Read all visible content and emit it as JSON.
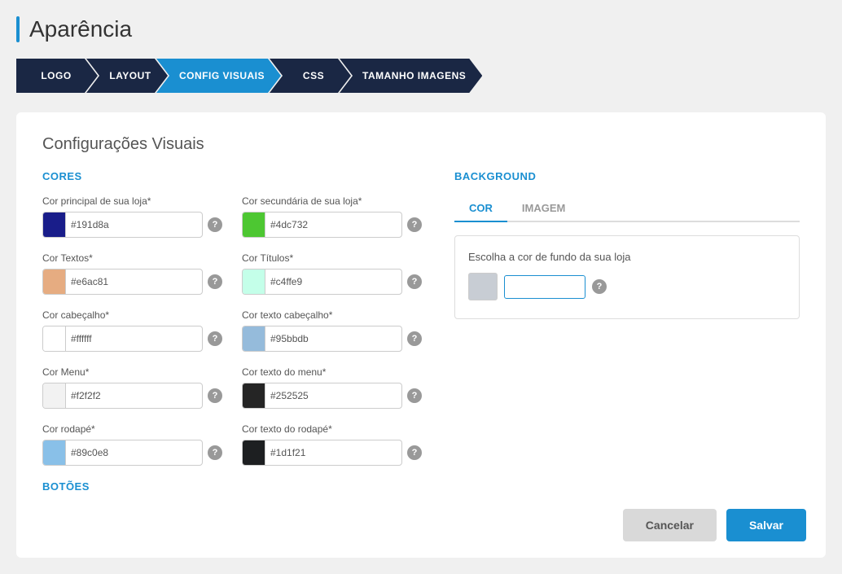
{
  "page": {
    "title": "Aparência"
  },
  "nav": {
    "steps": [
      {
        "id": "logo",
        "label": "LOGO",
        "active": false,
        "first": true
      },
      {
        "id": "layout",
        "label": "LAYOUT",
        "active": false,
        "first": false
      },
      {
        "id": "config-visuais",
        "label": "CONFIG VISUAIS",
        "active": true,
        "first": false
      },
      {
        "id": "css",
        "label": "CSS",
        "active": false,
        "first": false
      },
      {
        "id": "tamanho-imagens",
        "label": "TAMANHO IMAGENS",
        "active": false,
        "first": false
      }
    ]
  },
  "main": {
    "section_title": "Configurações Visuais",
    "cores_heading": "CORES",
    "botoes_heading": "BOTÕES",
    "colors": [
      {
        "row": [
          {
            "label": "Cor principal de sua loja*",
            "hex": "#191d8a",
            "swatch": "#191d8a"
          },
          {
            "label": "Cor secundária de sua loja*",
            "hex": "#4dc732",
            "swatch": "#4dc732"
          }
        ]
      },
      {
        "row": [
          {
            "label": "Cor Textos*",
            "hex": "#e6ac81",
            "swatch": "#e6ac81"
          },
          {
            "label": "Cor Títulos*",
            "hex": "#c4ffe9",
            "swatch": "#c4ffe9"
          }
        ]
      },
      {
        "row": [
          {
            "label": "Cor cabeçalho*",
            "hex": "#ffffff",
            "swatch": "#ffffff"
          },
          {
            "label": "Cor texto cabeçalho*",
            "hex": "#95bbdb",
            "swatch": "#95bbdb"
          }
        ]
      },
      {
        "row": [
          {
            "label": "Cor Menu*",
            "hex": "#f2f2f2",
            "swatch": "#f2f2f2"
          },
          {
            "label": "Cor texto do menu*",
            "hex": "#252525",
            "swatch": "#252525"
          }
        ]
      },
      {
        "row": [
          {
            "label": "Cor rodapé*",
            "hex": "#89c0e8",
            "swatch": "#89c0e8"
          },
          {
            "label": "Cor texto do rodapé*",
            "hex": "#1d1f21",
            "swatch": "#1d1f21"
          }
        ]
      }
    ],
    "background": {
      "heading": "BACKGROUND",
      "tabs": [
        {
          "id": "cor",
          "label": "COR",
          "active": true
        },
        {
          "id": "imagem",
          "label": "IMAGEM",
          "active": false
        }
      ],
      "cor_label": "Escolha a cor de fundo da sua loja",
      "cor_hex": "",
      "cor_swatch": "#c8cdd4"
    },
    "actions": {
      "cancel_label": "Cancelar",
      "save_label": "Salvar"
    }
  }
}
